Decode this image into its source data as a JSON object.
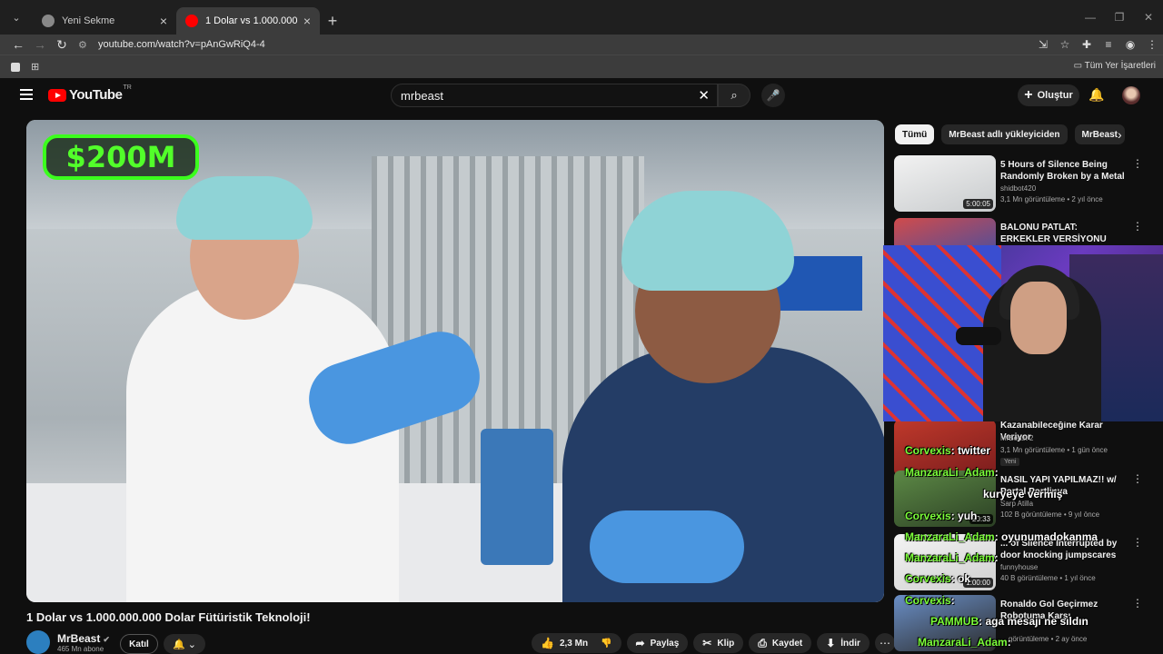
{
  "browser": {
    "tabs": [
      {
        "title": "Yeni Sekme",
        "active": false
      },
      {
        "title": "1 Dolar vs 1.000.000.000 Dolar Fütüristik Teknoloji!",
        "active": true
      }
    ],
    "url": "youtube.com/watch?v=pAnGwRiQ4-4",
    "bookmarks_label": "Tüm Yer İşaretleri"
  },
  "youtube": {
    "logo_text": "YouTube",
    "country_code": "TR",
    "search_value": "mrbeast",
    "create_label": "Oluştur"
  },
  "video": {
    "overlay_text": "$200M",
    "title": "1 Dolar vs 1.000.000.000 Dolar Fütüristik Teknoloji!",
    "channel_name": "MrBeast",
    "subscribers": "465 Mn abone",
    "join_label": "Katıl",
    "likes": "2,3 Mn",
    "share_label": "Paylaş",
    "clip_label": "Klip",
    "save_label": "Kaydet",
    "download_label": "İndir"
  },
  "chips": [
    "Tümü",
    "MrBeast adlı yükleyiciden",
    "MrBeast"
  ],
  "recommendations": [
    {
      "title": "5 Hours of Silence Being Randomly Broken by a Metal ...",
      "channel": "shidbot420",
      "meta": "3,1 Mn görüntüleme • 2 yıl önce",
      "duration": "5:00:05",
      "thumb": "#cfd3d6"
    },
    {
      "title": "BALONU PATLAT: ERKEKLER VERSİYONU",
      "channel": "",
      "meta": "",
      "duration": "",
      "thumb": "#b83a3a"
    },
    {
      "title": "Kazanabileceğine Karar Veriyor",
      "channel": "MrBeast 2",
      "meta": "3,1 Mn görüntüleme • 1 gün önce",
      "duration": "",
      "thumb": "#c0392b",
      "badge": "Yeni"
    },
    {
      "title": "NASIL YAPI YAPILMAZ!! w/ Portal Portlinya",
      "channel": "Sarp Atilla",
      "meta": "102 B görüntüleme • 9 yıl önce",
      "duration": "20:33",
      "thumb": "#4a7a3a"
    },
    {
      "title": "... of Silence Interrupted by door knocking jumpscares",
      "channel": "funnyhouse",
      "meta": "40 B görüntüleme • 1 yıl önce",
      "duration": "1:00:00",
      "thumb": "#e9e9e9"
    },
    {
      "title": "Ronaldo Gol Geçirmez Robotuma Karşı",
      "channel": "Mark Rober ve UR · Cristiano",
      "meta": "... görüntüleme • 2 ay önce",
      "duration": "",
      "thumb": "#6a8fc7"
    }
  ],
  "chat": [
    {
      "user": "Corvexis",
      "msg": ": twitter"
    },
    {
      "user": "ManzaraLi_Adam",
      "msg": ":"
    },
    {
      "user": "",
      "msg": "kuryeye vermiş"
    },
    {
      "user": "Corvexis",
      "msg": ": yuh"
    },
    {
      "user": "ManzaraLi_Adam",
      "msg": ": oyunumadokanma"
    },
    {
      "user": "ManzaraLi_Adam",
      "msg": ":"
    },
    {
      "user": "Corvexis",
      "msg": ": ok"
    },
    {
      "user": "Corvexis",
      "msg": ":"
    },
    {
      "user": "PAMMUB",
      "msg": ": aga mesajı ne sıldın"
    },
    {
      "user": "ManzaraLi_Adam",
      "msg": ":"
    }
  ],
  "colors": {
    "accent": "#ff0000",
    "chat_user": "#7cff3a",
    "overlay_green": "#52ff2a"
  }
}
